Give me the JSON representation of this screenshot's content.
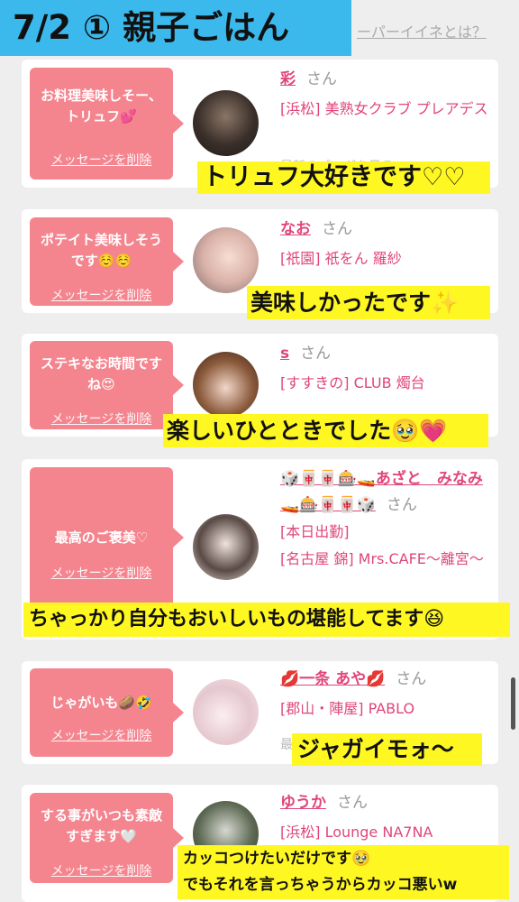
{
  "header": {
    "title": "7/2 ① 親子ごはん",
    "link": "ーパーイイネとは？"
  },
  "cards": [
    {
      "message": "お料理美味しそー、トリュフ💕",
      "delete": "メッセージを削除",
      "cast": "彩",
      "san": "さん",
      "shop": "[浜松] 美熟女クラブ プレアデス",
      "blog": "最新のブログを見る",
      "caption": "トリュフ大好きです♡♡"
    },
    {
      "message": "ポテイト美味しそうです☺️☺️",
      "delete": "メッセージを削除",
      "cast": "なお",
      "san": "さん",
      "shop": "[祇園] 祇をん 羅紗",
      "blog": "最新のブログを見る",
      "caption": "美味しかったです✨"
    },
    {
      "message": "ステキなお時間ですね😍",
      "delete": "メッセージを削除",
      "cast": "s",
      "san": "さん",
      "shop": "[すすきの] CLUB 燭台",
      "blog": "最新のブログを見る",
      "caption": "楽しいひとときでした🥹💗"
    },
    {
      "message": "最高のご褒美♡",
      "delete": "メッセージを削除",
      "cast": "🎲🀄🀄🎰🚤あざと　みなみ🚤🎰🀄🀄🎲",
      "san": "さん",
      "shop": "[本日出勤]",
      "shop2": "[名古屋 錦] Mrs.CAFE〜離宮〜",
      "caption": "ちゃっかり自分もおいしいもの堪能してます😆"
    },
    {
      "message": "じゃがいも🥔🤣",
      "delete": "メッセージを削除",
      "cast": "💋一条 あや💋",
      "san": "さん",
      "shop": "[郡山・陣屋] PABLO",
      "blog": "最",
      "caption": "ジャガイモォ〜"
    },
    {
      "message": "する事がいつも素敵すぎます🤍",
      "delete": "メッセージを削除",
      "cast": "ゆうか",
      "san": "さん",
      "shop": "[浜松] Lounge NA7NA",
      "caption": "カッコつけたいだけです🥹",
      "caption2": "でもそれを言っちゃうからカッコ悪いw"
    }
  ],
  "colors": {
    "title_bg": "#3bb8ec",
    "bubble": "#f4858f",
    "cast_text": "#e0467a",
    "caption_bg": "#fff721"
  }
}
